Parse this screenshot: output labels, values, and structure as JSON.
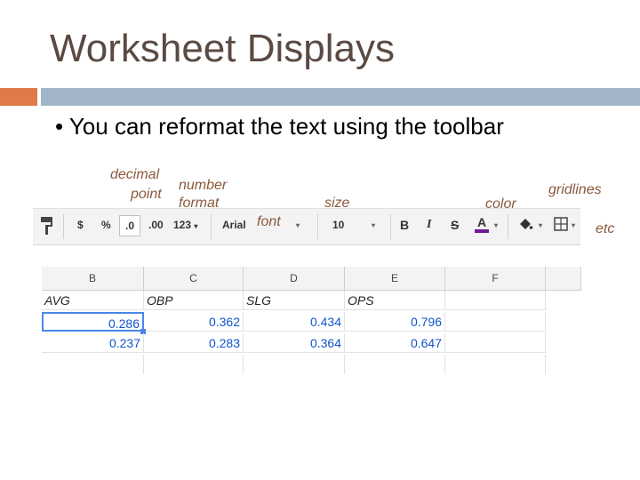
{
  "slide": {
    "title": "Worksheet Displays",
    "bullet": "• You can reformat the text using the toolbar"
  },
  "annotations": {
    "decimal": "decimal",
    "point": "point",
    "number": "number",
    "format": "format",
    "font": "font",
    "size": "size",
    "color": "color",
    "gridlines": "gridlines",
    "etc": "etc"
  },
  "toolbar": {
    "paint_format_icon": "paint-format-icon",
    "currency": "$",
    "percent": "%",
    "decrease_decimal": ".0",
    "increase_decimal": ".00",
    "number_format": "123",
    "font_name": "Arial",
    "font_size": "10",
    "bold": "B",
    "italic": "I",
    "strikethrough": "S",
    "text_color": "A",
    "text_color_value": "#6a1b9a"
  },
  "sheet": {
    "columns": [
      "B",
      "C",
      "D",
      "E",
      "F"
    ],
    "header_row": [
      "AVG",
      "OBP",
      "SLG",
      "OPS",
      ""
    ],
    "rows": [
      [
        "0.286",
        "0.362",
        "0.434",
        "0.796",
        ""
      ],
      [
        "0.237",
        "0.283",
        "0.364",
        "0.647",
        ""
      ]
    ]
  }
}
